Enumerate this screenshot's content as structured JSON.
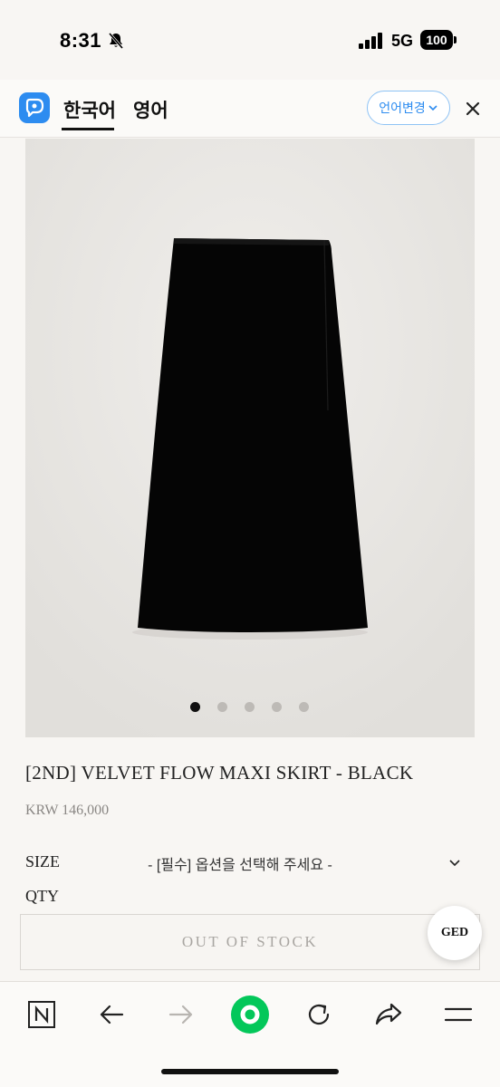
{
  "status": {
    "time": "8:31",
    "network": "5G",
    "battery": "100"
  },
  "translator": {
    "current_language": "한국어",
    "other_language": "영어",
    "change_label": "언어변경"
  },
  "product": {
    "title": "[2ND] VELVET FLOW MAXI SKIRT - BLACK",
    "price": "KRW 146,000",
    "image_count": 5,
    "active_image": 1,
    "size_label": "SIZE",
    "size_placeholder": "- [필수] 옵션을 선택해 주세요 -",
    "qty_label": "QTY",
    "out_of_stock_label": "OUT OF STOCK",
    "floating_badge": "GED"
  },
  "toolbar": {
    "items": [
      "naver-logo-icon",
      "back-arrow-icon",
      "forward-arrow-icon",
      "green-home-icon",
      "refresh-icon",
      "share-icon",
      "menu-icon"
    ]
  },
  "colors": {
    "accent_blue": "#2d8cf0",
    "green": "#03c75a",
    "page_bg": "#f8f6f3"
  }
}
